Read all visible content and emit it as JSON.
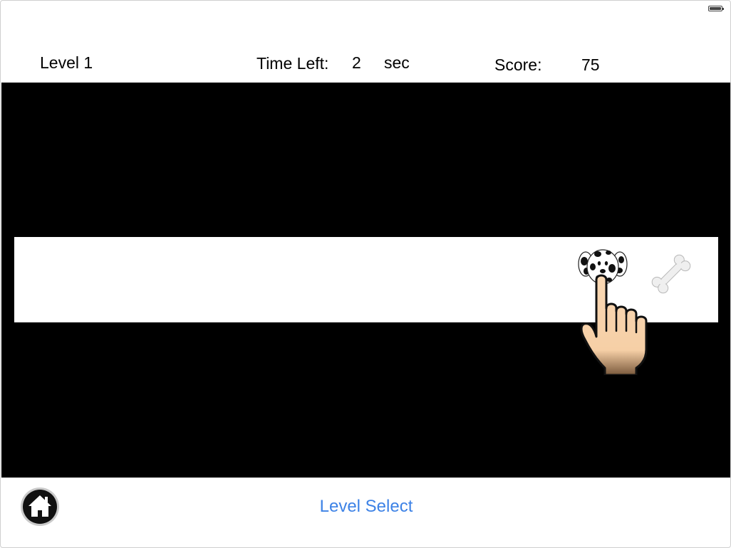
{
  "hud": {
    "level_label": "Level 1",
    "time_label": "Time Left:",
    "time_value": "2",
    "time_unit": "sec",
    "score_label": "Score:",
    "score_value": "75"
  },
  "footer": {
    "level_select_label": "Level Select"
  },
  "icons": {
    "battery": "battery-icon",
    "dog": "dalmatian-dog-icon",
    "bone": "bone-icon",
    "hand": "pointing-hand-icon",
    "home": "home-icon"
  },
  "colors": {
    "link": "#3d82e6",
    "play_area": "#000000",
    "lane": "#ffffff"
  }
}
